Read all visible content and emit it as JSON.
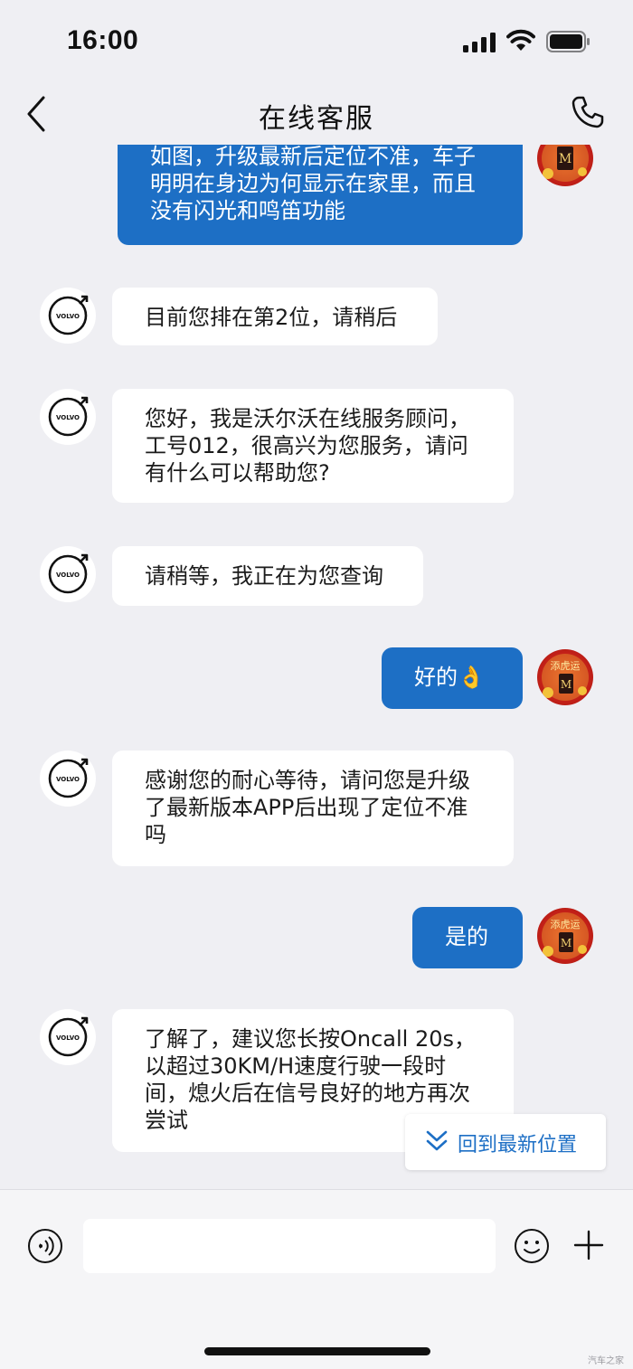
{
  "status_bar": {
    "time": "16:00"
  },
  "nav": {
    "title": "在线客服"
  },
  "colors": {
    "accent": "#1d6fc5",
    "background": "#efeff3",
    "incoming_bubble": "#ffffff",
    "avatar_red": "#c8221a"
  },
  "messages": [
    {
      "from": "user",
      "text": "如图，升级最新后定位不准，车子\n明明在身边为何显示在家里，而且\n没有闪光和鸣笛功能"
    },
    {
      "from": "agent",
      "text": "目前您排在第2位，请稍后"
    },
    {
      "from": "agent",
      "text": "您好，我是沃尔沃在线服务顾问，\n工号012，很高兴为您服务，请问\n有什么可以帮助您?"
    },
    {
      "from": "agent",
      "text": "请稍等，我正在为您查询"
    },
    {
      "from": "user",
      "text": "好的👌"
    },
    {
      "from": "agent",
      "text": "感谢您的耐心等待，请问您是升级\n了最新版本APP后出现了定位不准\n吗"
    },
    {
      "from": "user",
      "text": "是的"
    },
    {
      "from": "agent",
      "text": "了解了，建议您长按Oncall 20s，\n以超过30KM/H速度行驶一段时\n间，熄火后在信号良好的地方再次\n尝试"
    }
  ],
  "avatars": {
    "agent_logo_text": "VOLVO",
    "user_badge_text": "添虎运"
  },
  "jump_latest": {
    "label": "回到最新位置"
  },
  "input": {
    "value": "",
    "placeholder": ""
  },
  "watermark": "汽车之家"
}
